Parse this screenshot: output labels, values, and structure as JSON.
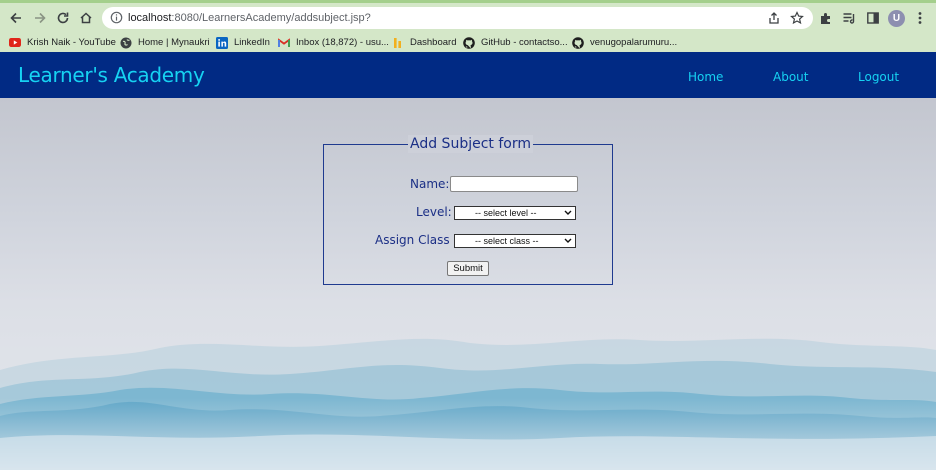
{
  "browser": {
    "url_host": "localhost",
    "url_rest": ":8080/LearnersAcademy/addsubject.jsp?",
    "profile_initial": "U",
    "bookmarks": [
      {
        "label": "Krish Naik - YouTube",
        "icon": "youtube-icon"
      },
      {
        "label": "Home | Mynaukri",
        "icon": "globe-icon"
      },
      {
        "label": "LinkedIn",
        "icon": "linkedin-icon"
      },
      {
        "label": "Inbox (18,872) - usu...",
        "icon": "gmail-icon"
      },
      {
        "label": "Dashboard",
        "icon": "dashboard-icon"
      },
      {
        "label": "GitHub - contactso...",
        "icon": "github-icon"
      },
      {
        "label": "venugopalarumuru...",
        "icon": "github-icon"
      }
    ]
  },
  "app": {
    "brand": "Learner's Academy",
    "nav": {
      "home": "Home",
      "about": "About",
      "logout": "Logout"
    },
    "colors": {
      "header_bg": "#012a84",
      "header_text": "#16d2f2",
      "form_text": "#1b2f86"
    }
  },
  "form": {
    "legend": "Add Subject form",
    "name_label": "Name:",
    "name_value": "",
    "level_label": "Level:",
    "level_selected": "-- select level --",
    "class_label": "Assign Class :",
    "class_selected": "-- select class --",
    "submit_label": "Submit"
  }
}
